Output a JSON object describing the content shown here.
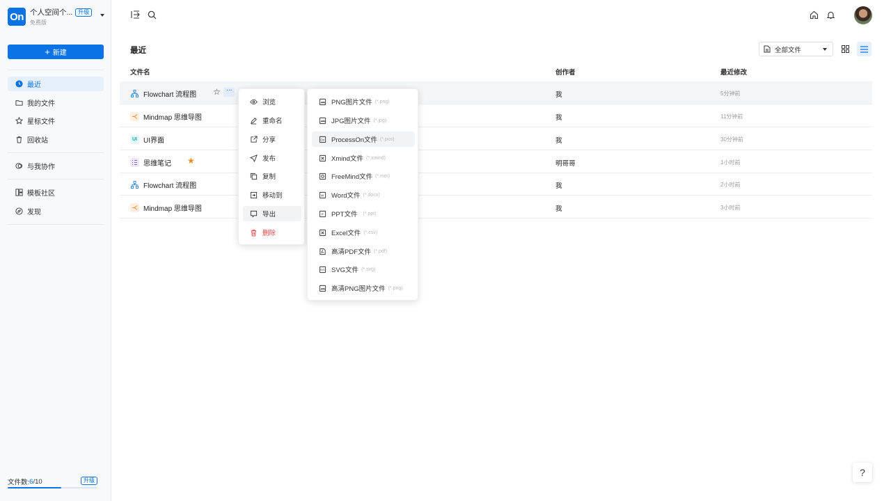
{
  "workspace": {
    "logo_text": "On",
    "name": "个人空间个...",
    "upgrade_label": "升级",
    "plan": "免费版"
  },
  "new_button": {
    "plus": "+",
    "label": "新建"
  },
  "nav": {
    "items": [
      {
        "label": "最近",
        "icon": "clock-icon",
        "active": true
      },
      {
        "label": "我的文件",
        "icon": "folder-icon"
      },
      {
        "label": "星标文件",
        "icon": "star-icon"
      },
      {
        "label": "回收站",
        "icon": "trash-icon"
      },
      {
        "label": "与我协作",
        "icon": "collab-icon"
      },
      {
        "label": "模板社区",
        "icon": "template-icon"
      },
      {
        "label": "发现",
        "icon": "compass-icon"
      }
    ]
  },
  "footer": {
    "label": "文件数: ",
    "current": "6",
    "total": "/10",
    "upgrade_label": "升级",
    "usage_fraction": 0.6
  },
  "main": {
    "title": "最近",
    "filter": {
      "label": "全部文件"
    }
  },
  "table": {
    "headers": {
      "name": "文件名",
      "creator": "创作者",
      "modified": "最近修改"
    },
    "rows": [
      {
        "name": "Flowchart 流程图",
        "type": "flowchart",
        "creator": "我",
        "time": "5分钟前"
      },
      {
        "name": "Mindmap 思维导图",
        "type": "mindmap",
        "creator": "我",
        "time": "11分钟前"
      },
      {
        "name": "UI界面",
        "type": "ui",
        "icon_text": "UI",
        "creator": "我",
        "time": "30分钟前"
      },
      {
        "name": "思维笔记",
        "type": "note",
        "creator": "明哥哥",
        "time": "1小时前",
        "starred": true
      },
      {
        "name": "Flowchart 流程图",
        "type": "flowchart",
        "creator": "我",
        "time": "2小时前"
      },
      {
        "name": "Mindmap 思维导图",
        "type": "mindmap",
        "creator": "我",
        "time": "3小时前"
      }
    ]
  },
  "context_menu": {
    "items": [
      {
        "label": "浏览",
        "icon": "eye-icon"
      },
      {
        "label": "重命名",
        "icon": "pen-icon"
      },
      {
        "label": "分享",
        "icon": "share-icon"
      },
      {
        "label": "发布",
        "icon": "send-icon"
      },
      {
        "label": "复制",
        "icon": "copy-icon"
      },
      {
        "label": "移动到",
        "icon": "move-icon"
      },
      {
        "label": "导出",
        "icon": "export-icon",
        "active": true
      },
      {
        "label": "删除",
        "icon": "delete-icon",
        "danger": true
      }
    ]
  },
  "export_menu": {
    "items": [
      {
        "label": "PNG图片文件",
        "ext": "(*.png)"
      },
      {
        "label": "JPG图片文件",
        "ext": "(*.jpg)"
      },
      {
        "label": "ProcessOn文件",
        "ext": "(*.pos)",
        "active": true
      },
      {
        "label": "Xmind文件",
        "ext": "(*.xmind)"
      },
      {
        "label": "FreeMind文件",
        "ext": "(*.mm)"
      },
      {
        "label": "Word文件",
        "ext": "(*.docx)"
      },
      {
        "label": "PPT文件",
        "ext": "(*.ppt)"
      },
      {
        "label": "Excel文件",
        "ext": "(*.csv)"
      },
      {
        "label": "高清PDF文件",
        "ext": "(*.pdf)"
      },
      {
        "label": "SVG文件",
        "ext": "(*.svg)"
      },
      {
        "label": "高清PNG图片文件",
        "ext": "(*.png)"
      }
    ]
  },
  "help": {
    "label": "?"
  },
  "colors": {
    "accent": "#0b73e6",
    "danger": "#e64545",
    "star": "#f28a1e"
  }
}
